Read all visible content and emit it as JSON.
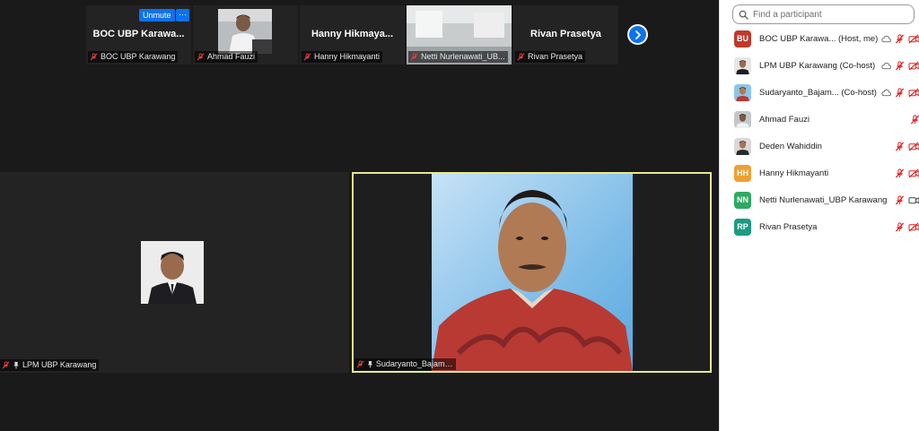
{
  "strip": {
    "tiles": [
      {
        "name": "BOC UBP Karawa...",
        "label": "BOC UBP Karawang"
      },
      {
        "name": "",
        "label": "Ahmad Fauzi"
      },
      {
        "name": "Hanny  Hikmaya...",
        "label": "Hanny Hikmayanti"
      },
      {
        "name": "",
        "label": "Netti Nurlenawati_UB..."
      },
      {
        "name": "Rivan Prasetya",
        "label": "Rivan Prasetya"
      }
    ],
    "unmute_label": "Unmute",
    "more_label": "···"
  },
  "main": {
    "left_label": "LPM UBP Karawang",
    "right_label": "Sudaryanto_Bajamtu UG"
  },
  "panel": {
    "search_placeholder": "Find a participant",
    "participants": [
      {
        "initials": "BU",
        "color": "#c0392b",
        "name": "BOC UBP Karawa...  (Host, me)",
        "cloud": true,
        "mic_muted": true,
        "video_off": true
      },
      {
        "initials": "",
        "color": "#5a6a85",
        "name": "LPM UBP Karawang (Co-host)",
        "cloud": true,
        "mic_muted": true,
        "video_off": true
      },
      {
        "initials": "",
        "color": "#6d7fa1",
        "name": "Sudaryanto_Bajam...  (Co-host)",
        "cloud": true,
        "mic_muted": true,
        "video_off": true
      },
      {
        "initials": "",
        "color": "#7b6b58",
        "name": "Ahmad Fauzi",
        "cloud": false,
        "mic_muted": true,
        "video_off": false
      },
      {
        "initials": "",
        "color": "#8a4a4a",
        "name": "Deden Wahiddin",
        "cloud": false,
        "mic_muted": true,
        "video_off": true
      },
      {
        "initials": "HH",
        "color": "#f0a030",
        "name": "Hanny Hikmayanti",
        "cloud": false,
        "mic_muted": true,
        "video_off": true
      },
      {
        "initials": "NN",
        "color": "#2eaa62",
        "name": "Netti Nurlenawati_UBP Karawang",
        "cloud": false,
        "mic_muted": true,
        "video_off": false
      },
      {
        "initials": "RP",
        "color": "#1d9a82",
        "name": "Rivan Prasetya",
        "cloud": false,
        "mic_muted": true,
        "video_off": true
      }
    ]
  }
}
